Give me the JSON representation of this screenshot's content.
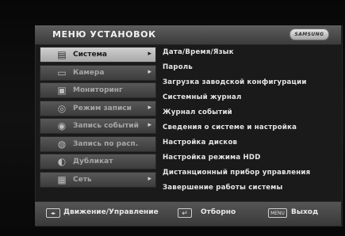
{
  "header": {
    "title": "МЕНЮ УСТАНОВОК",
    "brand": "SAMSUNG"
  },
  "menu": [
    {
      "label": "Система",
      "icon": "system-icon",
      "selected": true,
      "arrow": true
    },
    {
      "label": "Камера",
      "icon": "camera-icon",
      "selected": false,
      "arrow": true
    },
    {
      "label": "Мониторинг",
      "icon": "monitor-icon",
      "selected": false,
      "arrow": false
    },
    {
      "label": "Режим записи",
      "icon": "record-mode-icon",
      "selected": false,
      "arrow": true
    },
    {
      "label": "Запись событий",
      "icon": "event-record-icon",
      "selected": false,
      "arrow": true
    },
    {
      "label": "Запись по расп.",
      "icon": "schedule-record-icon",
      "selected": false,
      "arrow": false
    },
    {
      "label": "Дубликат",
      "icon": "backup-disc-icon",
      "selected": false,
      "arrow": false
    },
    {
      "label": "Сеть",
      "icon": "network-icon",
      "selected": false,
      "arrow": true
    }
  ],
  "submenu": [
    "Дата/Время/Язык",
    "Пароль",
    "Загрузка заводской конфигурации",
    "Системный журнал",
    "Журнал событий",
    "Сведения о системе и настройка",
    "Настройка дисков",
    "Настройка режима HDD",
    "Дистанционный прибор управления",
    "Завершение работы системы"
  ],
  "footer": {
    "move_label": "Движение/Управление",
    "enter_label": "Отборно",
    "menu_key": "MENU",
    "exit_label": "Выход"
  }
}
